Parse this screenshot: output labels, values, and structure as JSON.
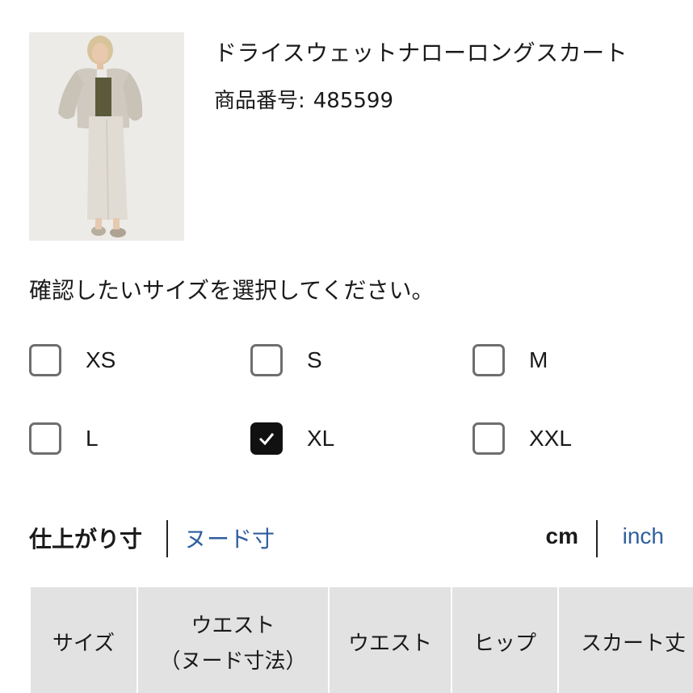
{
  "product": {
    "title": "ドライスウェットナローロングスカート",
    "number_label": "商品番号:",
    "number_value": "485599"
  },
  "size_selector": {
    "prompt": "確認したいサイズを選択してください。",
    "options": [
      {
        "label": "XS",
        "checked": false
      },
      {
        "label": "S",
        "checked": false
      },
      {
        "label": "M",
        "checked": false
      },
      {
        "label": "L",
        "checked": false
      },
      {
        "label": "XL",
        "checked": true
      },
      {
        "label": "XXL",
        "checked": false
      }
    ]
  },
  "measurement": {
    "tab_finished": "仕上がり寸",
    "tab_body": "ヌード寸",
    "unit_cm": "cm",
    "unit_inch": "inch",
    "active_link_color": "#2f5f9e"
  },
  "table": {
    "headers": {
      "size": "サイズ",
      "waist_nude_line1": "ウエスト",
      "waist_nude_line2": "（ヌード寸法）",
      "waist": "ウエスト",
      "hip": "ヒップ",
      "skirt_length": "スカート丈"
    }
  }
}
